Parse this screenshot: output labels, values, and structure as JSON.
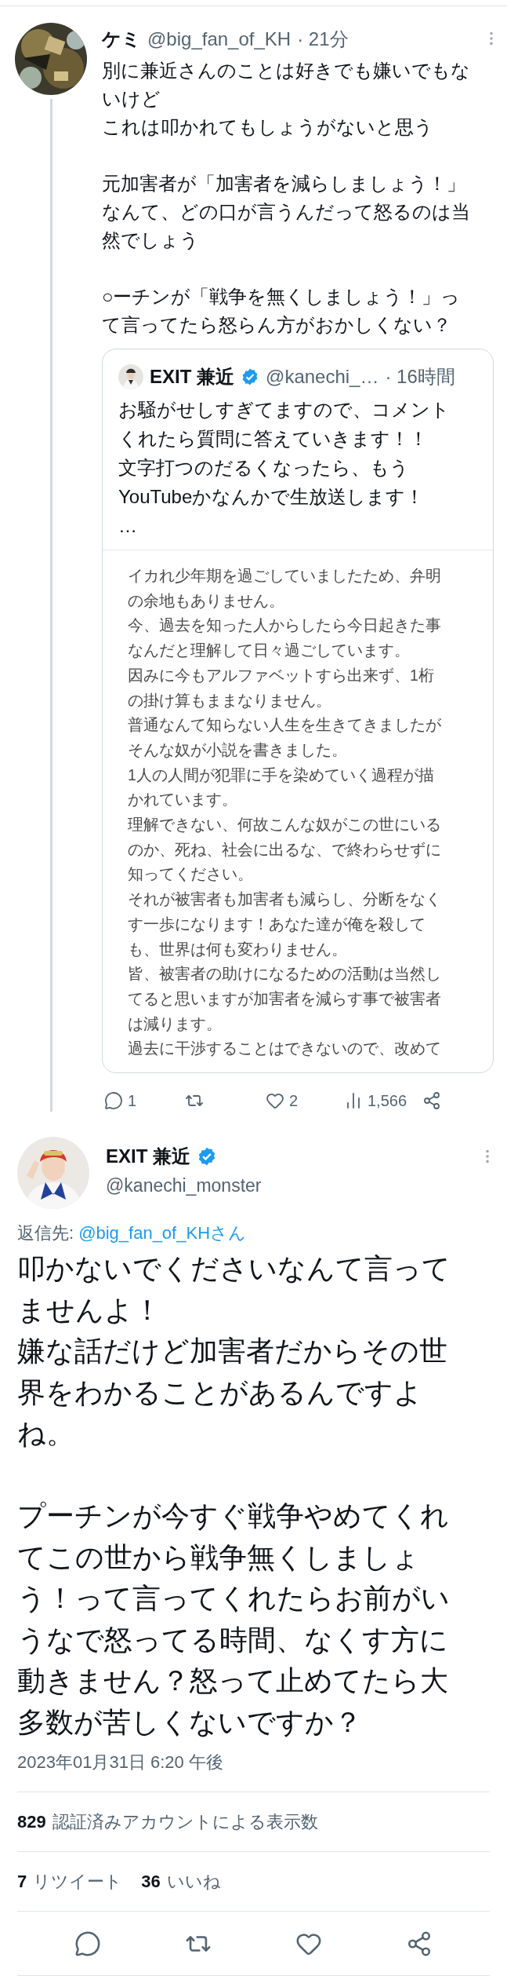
{
  "reply_tweet": {
    "author_name": "ケミ",
    "handle": "@big_fan_of_KH",
    "time": "· 21分",
    "paragraphs": [
      [
        "別に兼近さんのことは好きでも嫌いでもな",
        "いけど",
        "これは叩かれてもしょうがないと思う"
      ],
      [
        "元加害者が「加害者を減らしましょう！」",
        "なんて、どの口が言うんだって怒るのは当",
        "然でしょう"
      ],
      [
        "○ーチンが「戦争を無くしましょう！」っ",
        "て言ってたら怒らん方がおかしくない？"
      ]
    ],
    "quoted": {
      "author_name": "EXIT 兼近",
      "verified": true,
      "handle": "@kanechi_…",
      "time": "· 16時間",
      "lines": [
        "お騒がせしすぎてますので、コメント",
        "くれたら質問に答えていきます！！",
        "文字打つのだるくなったら、もう",
        "YouTubeかなんかで生放送します！",
        "…"
      ],
      "image_lines": [
        "イカれ少年期を過ごしていましたため、弁明",
        "の余地もありません。",
        "今、過去を知った人からしたら今日起きた事",
        "なんだと理解して日々過ごしています。",
        "因みに今もアルファベットすら出来ず、1桁",
        "の掛け算もままなりません。",
        "普通なんて知らない人生を生きてきましたが",
        "そんな奴が小説を書きました。",
        "1人の人間が犯罪に手を染めていく過程が描",
        "かれています。",
        "理解できない、何故こんな奴がこの世にいる",
        "のか、死ね、社会に出るな、で終わらせずに",
        "知ってください。",
        "それが被害者も加害者も減らし、分断をなく",
        "す一歩になります！あなた達が俺を殺して",
        "も、世界は何も変わりません。",
        "皆、被害者の助けになるための活動は当然し",
        "てると思いますが加害者を減らす事で被害者",
        "は減ります。",
        "過去に干渉することはできないので、改めて"
      ]
    },
    "actions": [
      {
        "kind": "reply",
        "count": "1"
      },
      {
        "kind": "retweet"
      },
      {
        "kind": "like",
        "count": "2"
      },
      {
        "kind": "views",
        "count": "1,566"
      },
      {
        "kind": "share"
      }
    ]
  },
  "focused_tweet": {
    "author_name": "EXIT 兼近",
    "verified": true,
    "handle": "@kanechi_monster",
    "reply_to_label": "返信先:",
    "reply_to": "@big_fan_of_KHさん",
    "paragraphs": [
      [
        "叩かないでくださいなんて言って",
        "ませんよ！",
        "嫌な話だけど加害者だからその世",
        "界をわかることがあるんですよ",
        "ね。"
      ],
      [
        "プーチンが今すぐ戦争やめてくれ",
        "てこの世から戦争無くしましょ",
        "う！って言ってくれたらお前がい",
        "うなで怒ってる時間、なくす方に",
        "動きません？怒って止めてたら大",
        "多数が苦しくないですか？"
      ]
    ],
    "timestamp": "2023年01月31日 6:20 午後",
    "views_count": "829",
    "views_label": "認証済みアカウントによる表示数",
    "stats": [
      {
        "count": "7",
        "label": "リツイート"
      },
      {
        "count": "36",
        "label": "いいね"
      }
    ],
    "actions": [
      {
        "kind": "reply"
      },
      {
        "kind": "retweet"
      },
      {
        "kind": "like"
      },
      {
        "kind": "share"
      }
    ]
  }
}
